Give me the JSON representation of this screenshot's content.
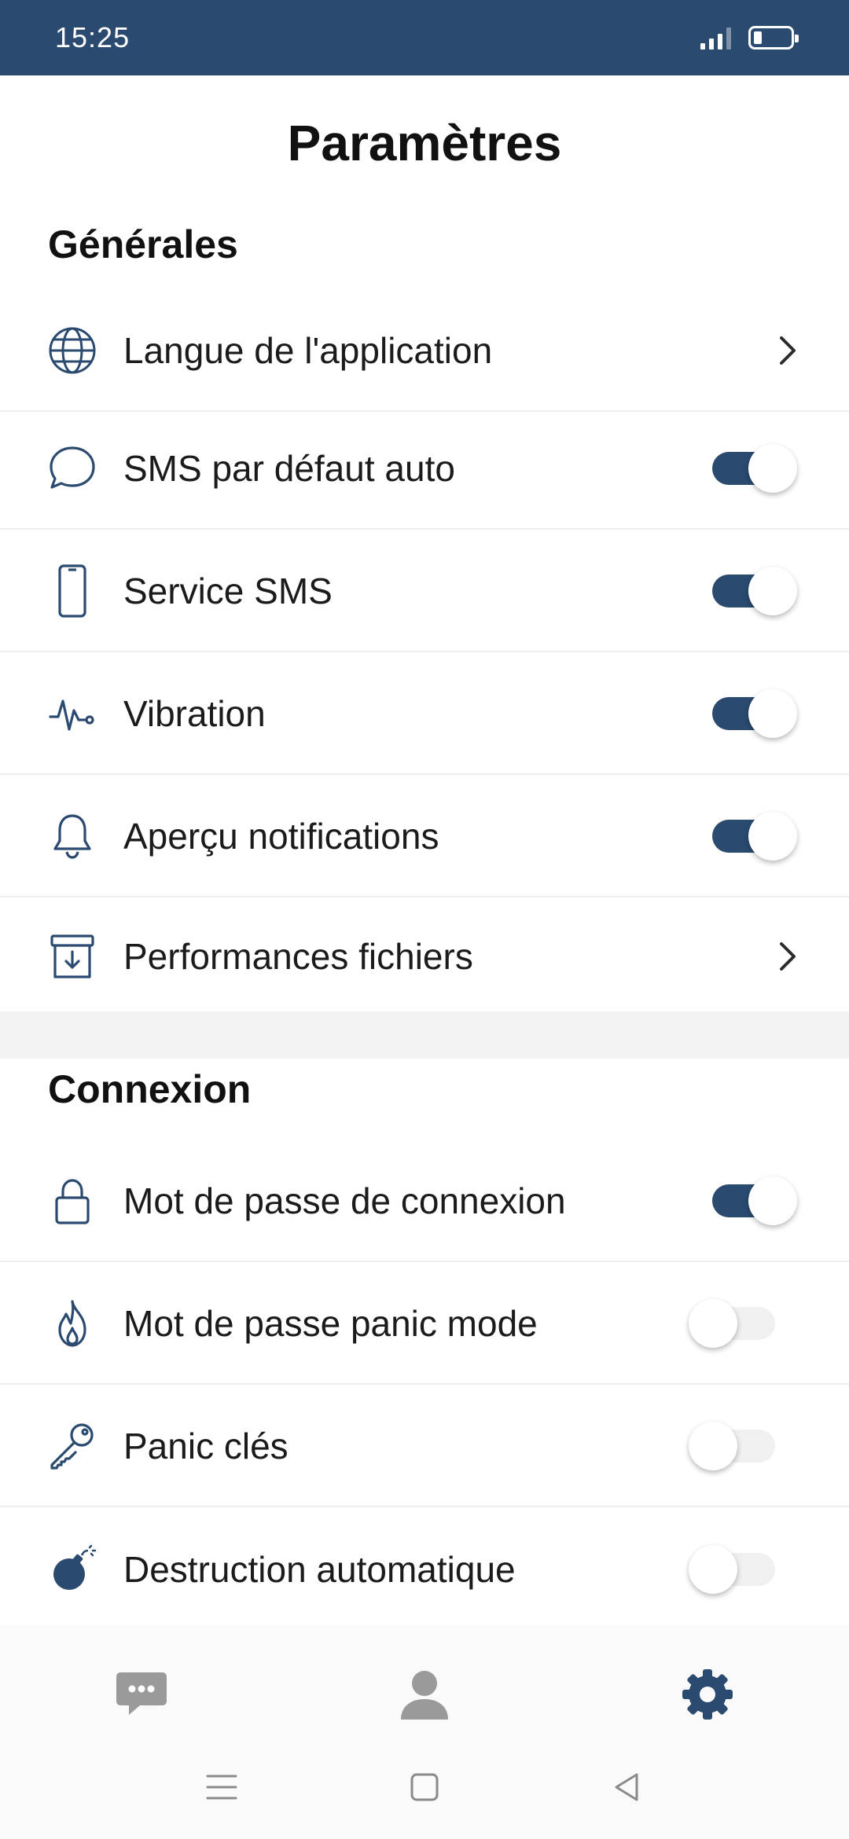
{
  "status_bar": {
    "time": "15:25"
  },
  "page": {
    "title": "Paramètres"
  },
  "sections": {
    "general": {
      "title": "Générales",
      "items": [
        {
          "label": "Langue de l'application",
          "icon": "globe-icon",
          "control": "chevron"
        },
        {
          "label": "SMS par défaut auto",
          "icon": "chat-bubble-icon",
          "control": "toggle",
          "value": true
        },
        {
          "label": "Service SMS",
          "icon": "smartphone-icon",
          "control": "toggle",
          "value": true
        },
        {
          "label": "Vibration",
          "icon": "pulse-icon",
          "control": "toggle",
          "value": true
        },
        {
          "label": "Aperçu notifications",
          "icon": "bell-icon",
          "control": "toggle",
          "value": true
        },
        {
          "label": "Performances fichiers",
          "icon": "archive-download-icon",
          "control": "chevron"
        }
      ]
    },
    "connection": {
      "title": "Connexion",
      "items": [
        {
          "label": "Mot de passe de connexion",
          "icon": "lock-icon",
          "control": "toggle",
          "value": true
        },
        {
          "label": "Mot de passe panic mode",
          "icon": "flame-icon",
          "control": "toggle",
          "value": false
        },
        {
          "label": "Panic clés",
          "icon": "key-icon",
          "control": "toggle",
          "value": false
        },
        {
          "label": "Destruction automatique",
          "icon": "bomb-icon",
          "control": "toggle",
          "value": false
        }
      ]
    }
  },
  "bottom_nav": {
    "items": [
      {
        "icon": "messages-icon",
        "active": false
      },
      {
        "icon": "contacts-icon",
        "active": false
      },
      {
        "icon": "settings-gear-icon",
        "active": true
      }
    ]
  },
  "colors": {
    "primary": "#2a4a6f",
    "inactive": "#9a9a9a"
  }
}
